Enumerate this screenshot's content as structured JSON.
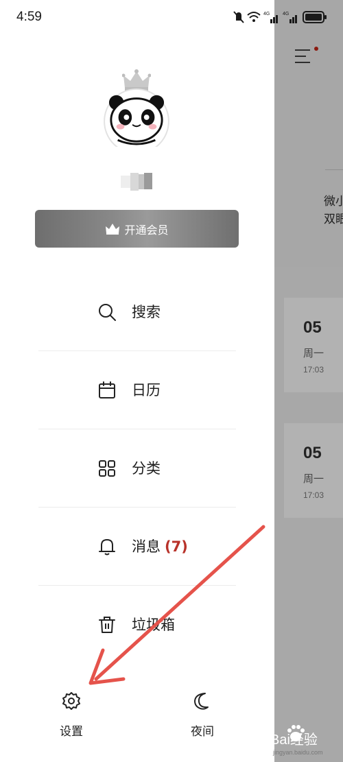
{
  "status_bar": {
    "time": "4:59"
  },
  "drawer": {
    "vip_label": "开通会员",
    "menu": [
      {
        "label": "搜索",
        "icon": "search-icon"
      },
      {
        "label": "日历",
        "icon": "calendar-icon"
      },
      {
        "label": "分类",
        "icon": "grid-icon"
      },
      {
        "label": "消息",
        "badge": "(7)",
        "icon": "bell-icon"
      },
      {
        "label": "垃圾箱",
        "icon": "trash-icon"
      }
    ],
    "bottom": {
      "settings_label": "设置",
      "night_label": "夜间"
    }
  },
  "background": {
    "text_line1": "微小",
    "text_line2": "双眼",
    "cards": [
      {
        "day": "05",
        "weekday": "周一",
        "time": "17:03"
      },
      {
        "day": "05",
        "weekday": "周一",
        "time": "17:03"
      }
    ]
  },
  "watermark": {
    "brand": "Bai经验",
    "url": "jingyan.baidu.com"
  },
  "colors": {
    "badge": "#b8322a",
    "annotation_arrow": "#e5534b",
    "vip_button": "#7a7a7a"
  }
}
